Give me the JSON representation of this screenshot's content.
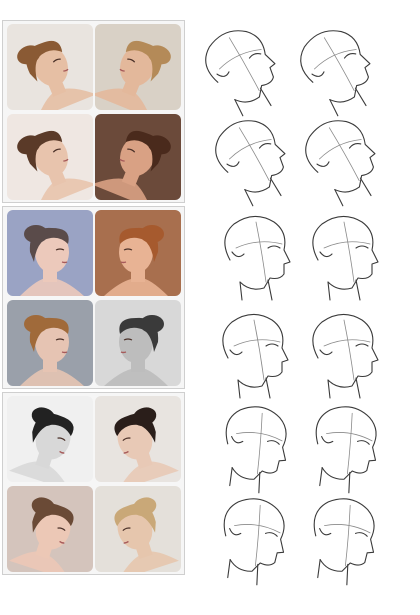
{
  "reference_photos": [
    {
      "name": "braided-updo-head-tilted-back",
      "bg": "#e9e4df",
      "skin": "#e6bfa4",
      "hair": "#8a5a34"
    },
    {
      "name": "blonde-headband-head-tilted-back",
      "bg": "#d9d1c6",
      "skin": "#e3b89b",
      "hair": "#b48a58"
    },
    {
      "name": "hands-on-head-looking-up",
      "bg": "#efe7e2",
      "skin": "#e8c4ad",
      "hair": "#5a3a28"
    },
    {
      "name": "profile-looking-up-earring",
      "bg": "#6b4a3a",
      "skin": "#d9a184",
      "hair": "#4a2a1c"
    },
    {
      "name": "floral-updo-three-quarter",
      "bg": "#9aa3c4",
      "skin": "#ecc9bb",
      "hair": "#5a4b4a"
    },
    {
      "name": "redhead-looking-down",
      "bg": "#a86f4e",
      "skin": "#e8b394",
      "hair": "#a65a2e"
    },
    {
      "name": "blue-eyeshadow-three-quarter",
      "bg": "#9aa0aa",
      "skin": "#e6c4b3",
      "hair": "#a06a3a"
    },
    {
      "name": "bw-braided-looking-down",
      "bg": "#d8d8d8",
      "skin": "#bdbdbd",
      "hair": "#3a3a3a"
    },
    {
      "name": "bw-messy-bun-looking-down",
      "bg": "#f0f0f0",
      "skin": "#d8d8d8",
      "hair": "#222222"
    },
    {
      "name": "hair-jewel-looking-down",
      "bg": "#e8e4e0",
      "skin": "#e8c9b6",
      "hair": "#2a1e1a"
    },
    {
      "name": "tiara-looking-down",
      "bg": "#d4c4bc",
      "skin": "#ecc8b6",
      "hair": "#6a4a36"
    },
    {
      "name": "blonde-updo-profile-down",
      "bg": "#e4e0da",
      "skin": "#e6c6ad",
      "hair": "#c9a878"
    }
  ],
  "sketch_heads": [
    {
      "name": "head-tilt-back-1"
    },
    {
      "name": "head-tilt-back-2"
    },
    {
      "name": "head-tilt-up-3"
    },
    {
      "name": "head-tilt-up-4"
    },
    {
      "name": "head-three-quarter-5"
    },
    {
      "name": "head-three-quarter-6"
    },
    {
      "name": "head-three-quarter-7"
    },
    {
      "name": "head-three-quarter-8"
    },
    {
      "name": "head-tilt-down-9"
    },
    {
      "name": "head-tilt-down-10"
    },
    {
      "name": "head-tilt-down-11"
    },
    {
      "name": "head-tilt-down-12"
    }
  ],
  "colors": {
    "panel_border": "#cfcfcf",
    "sketch_stroke": "#3a3a3a"
  }
}
